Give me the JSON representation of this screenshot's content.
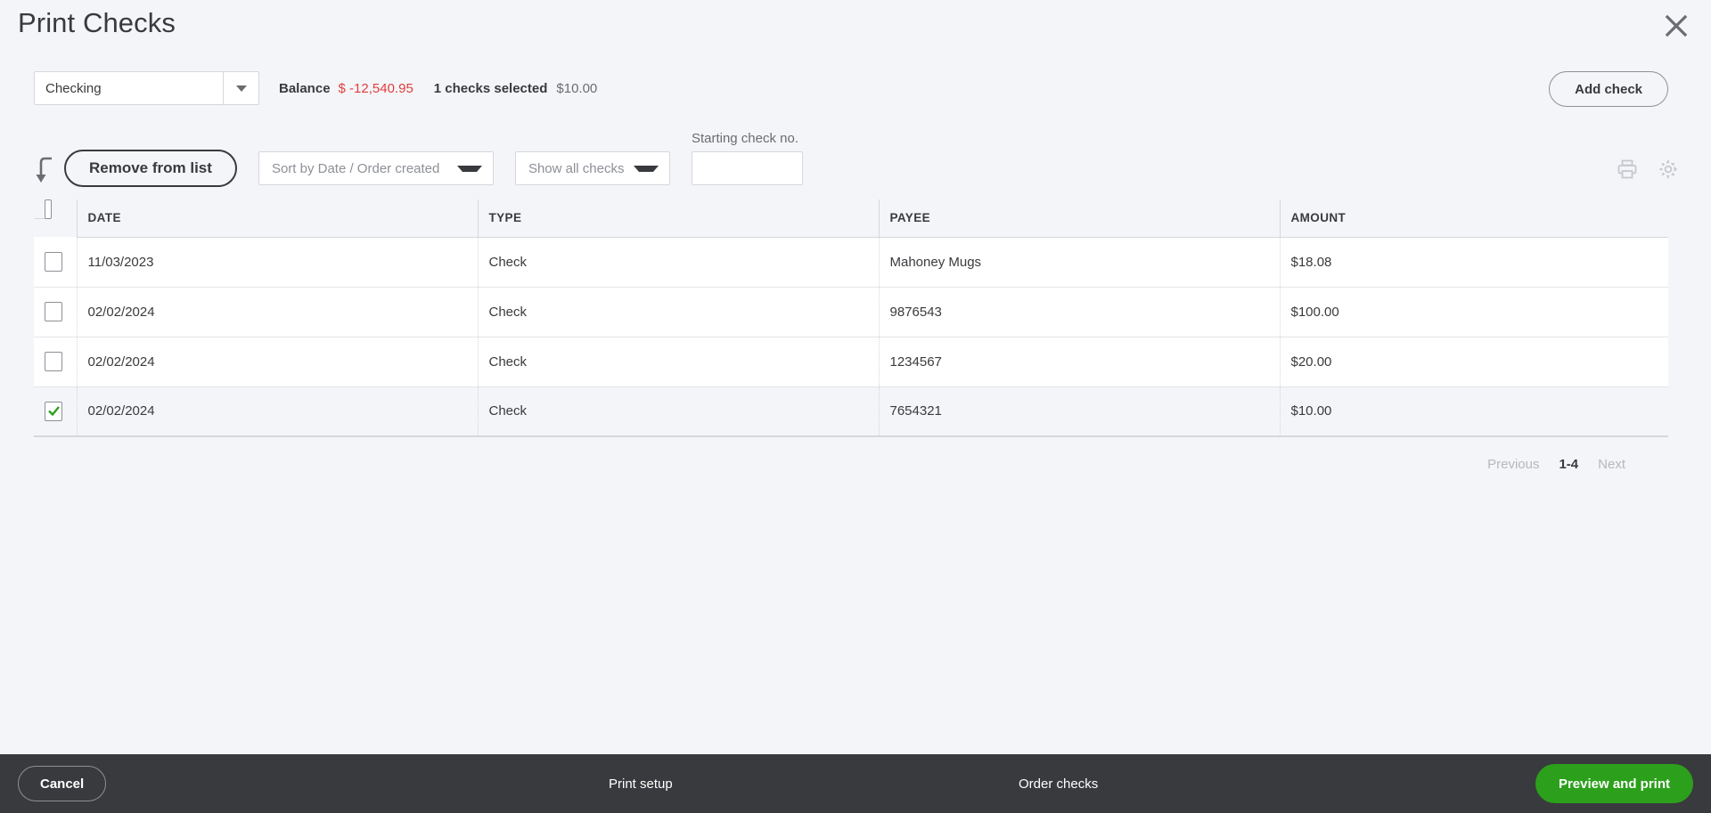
{
  "header": {
    "title": "Print Checks",
    "close_label": "Close"
  },
  "account_bar": {
    "account_value": "Checking",
    "balance_label": "Balance",
    "balance_value": "$ -12,540.95",
    "balance_color": "#e03e3e",
    "checks_selected_label": "1 checks selected",
    "checks_selected_amount": "$10.00",
    "add_check_label": "Add check"
  },
  "toolbar": {
    "remove_label": "Remove from list",
    "sort_value": "Sort by Date / Order created",
    "show_value": "Show all checks",
    "starting_check_label": "Starting check no.",
    "starting_check_value": "",
    "starting_check_placeholder": ""
  },
  "table": {
    "columns": [
      "DATE",
      "TYPE",
      "PAYEE",
      "AMOUNT"
    ],
    "rows": [
      {
        "checked": false,
        "date": "11/03/2023",
        "type": "Check",
        "payee": "Mahoney Mugs",
        "amount": "$18.08"
      },
      {
        "checked": false,
        "date": "02/02/2024",
        "type": "Check",
        "payee": "9876543",
        "amount": "$100.00"
      },
      {
        "checked": false,
        "date": "02/02/2024",
        "type": "Check",
        "payee": "1234567",
        "amount": "$20.00"
      },
      {
        "checked": true,
        "date": "02/02/2024",
        "type": "Check",
        "payee": "7654321",
        "amount": "$10.00"
      }
    ]
  },
  "pagination": {
    "previous": "Previous",
    "range": "1-4",
    "next": "Next"
  },
  "footer": {
    "cancel_label": "Cancel",
    "print_setup_label": "Print setup",
    "order_checks_label": "Order checks",
    "preview_label": "Preview and print",
    "preview_color": "#2ca01c",
    "background_color": "#393a3d"
  }
}
